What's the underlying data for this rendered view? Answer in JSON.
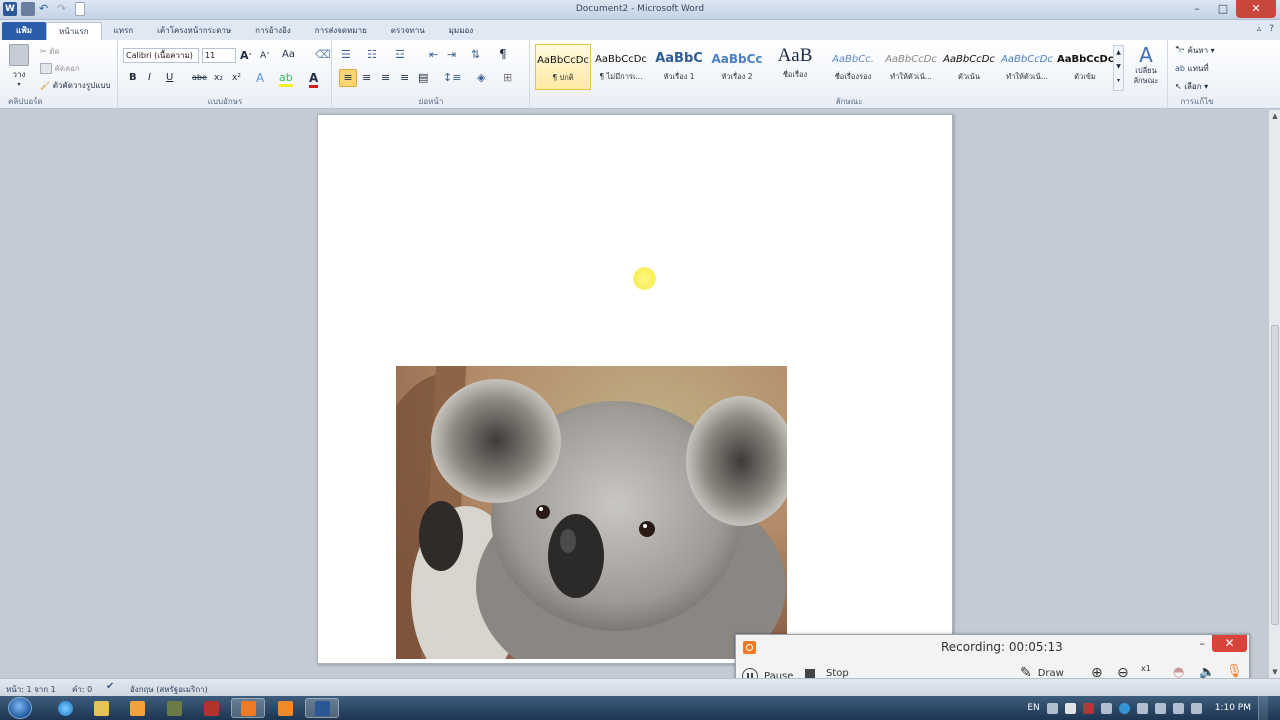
{
  "window": {
    "title": "Document2 - Microsoft Word",
    "minimize": "–",
    "maximize": "□",
    "close": "✕"
  },
  "tabs": [
    "แฟ้ม",
    "หน้าแรก",
    "แทรก",
    "เค้าโครงหน้ากระดาษ",
    "การอ้างอิง",
    "การส่งจดหมาย",
    "ตรวจทาน",
    "มุมมอง"
  ],
  "ribbon": {
    "clipboard": {
      "paste": "วาง",
      "cut": "ตัด",
      "copy": "คัดลอก",
      "format_painter": "ตัวคัดวางรูปแบบ",
      "label": "คลิปบอร์ด"
    },
    "font": {
      "family": "Calibri (เนื้อความ)",
      "size": "11",
      "label": "แบบอักษร",
      "aa": "Aa",
      "buttons": [
        "B",
        "I",
        "U",
        "abe",
        "x₂",
        "x²"
      ]
    },
    "paragraph": {
      "label": "ย่อหน้า",
      "pilcrow": "¶"
    },
    "styles": {
      "label": "ลักษณะ",
      "items": [
        {
          "sample": "AaBbCcDc",
          "name": "¶ ปกติ"
        },
        {
          "sample": "AaBbCcDc",
          "name": "¶ ไม่มีการเ..."
        },
        {
          "sample": "AaBbC",
          "name": "หัวเรื่อง 1"
        },
        {
          "sample": "AaBbCc",
          "name": "หัวเรื่อง 2"
        },
        {
          "sample": "AaB",
          "name": "ชื่อเรื่อง"
        },
        {
          "sample": "AaBbCc.",
          "name": "ชื่อเรื่องรอง"
        },
        {
          "sample": "AaBbCcDc",
          "name": "ทำให้ตัวเน้..."
        },
        {
          "sample": "AaBbCcDc",
          "name": "ตัวเน้น"
        },
        {
          "sample": "AaBbCcDc",
          "name": "ทำให้ตัวเน้..."
        },
        {
          "sample": "AaBbCcDc",
          "name": "ตัวเข้ม"
        }
      ],
      "change_styles": "เปลี่ยน\nลักษณะ"
    },
    "editing": {
      "label": "การแก้ไข",
      "find": "ค้นหา",
      "replace": "แทนที่",
      "select": "เลือก"
    }
  },
  "recorder": {
    "title": "Recording:  00:05:13",
    "pause": "Pause",
    "stop": "Stop",
    "draw": "Draw",
    "zoom_level": "x1",
    "minimize": "–",
    "close": "✕"
  },
  "statusbar": {
    "page": "หน้า: 1 จาก 1",
    "words": "คำ: 0",
    "language": "อังกฤษ (สหรัฐอเมริกา)"
  },
  "taskbar": {
    "language": "EN",
    "time": "1:10 PM"
  },
  "colors": {
    "accent": "#2b5da8",
    "record_orange": "#f07b24",
    "close_red": "#d8433a"
  }
}
